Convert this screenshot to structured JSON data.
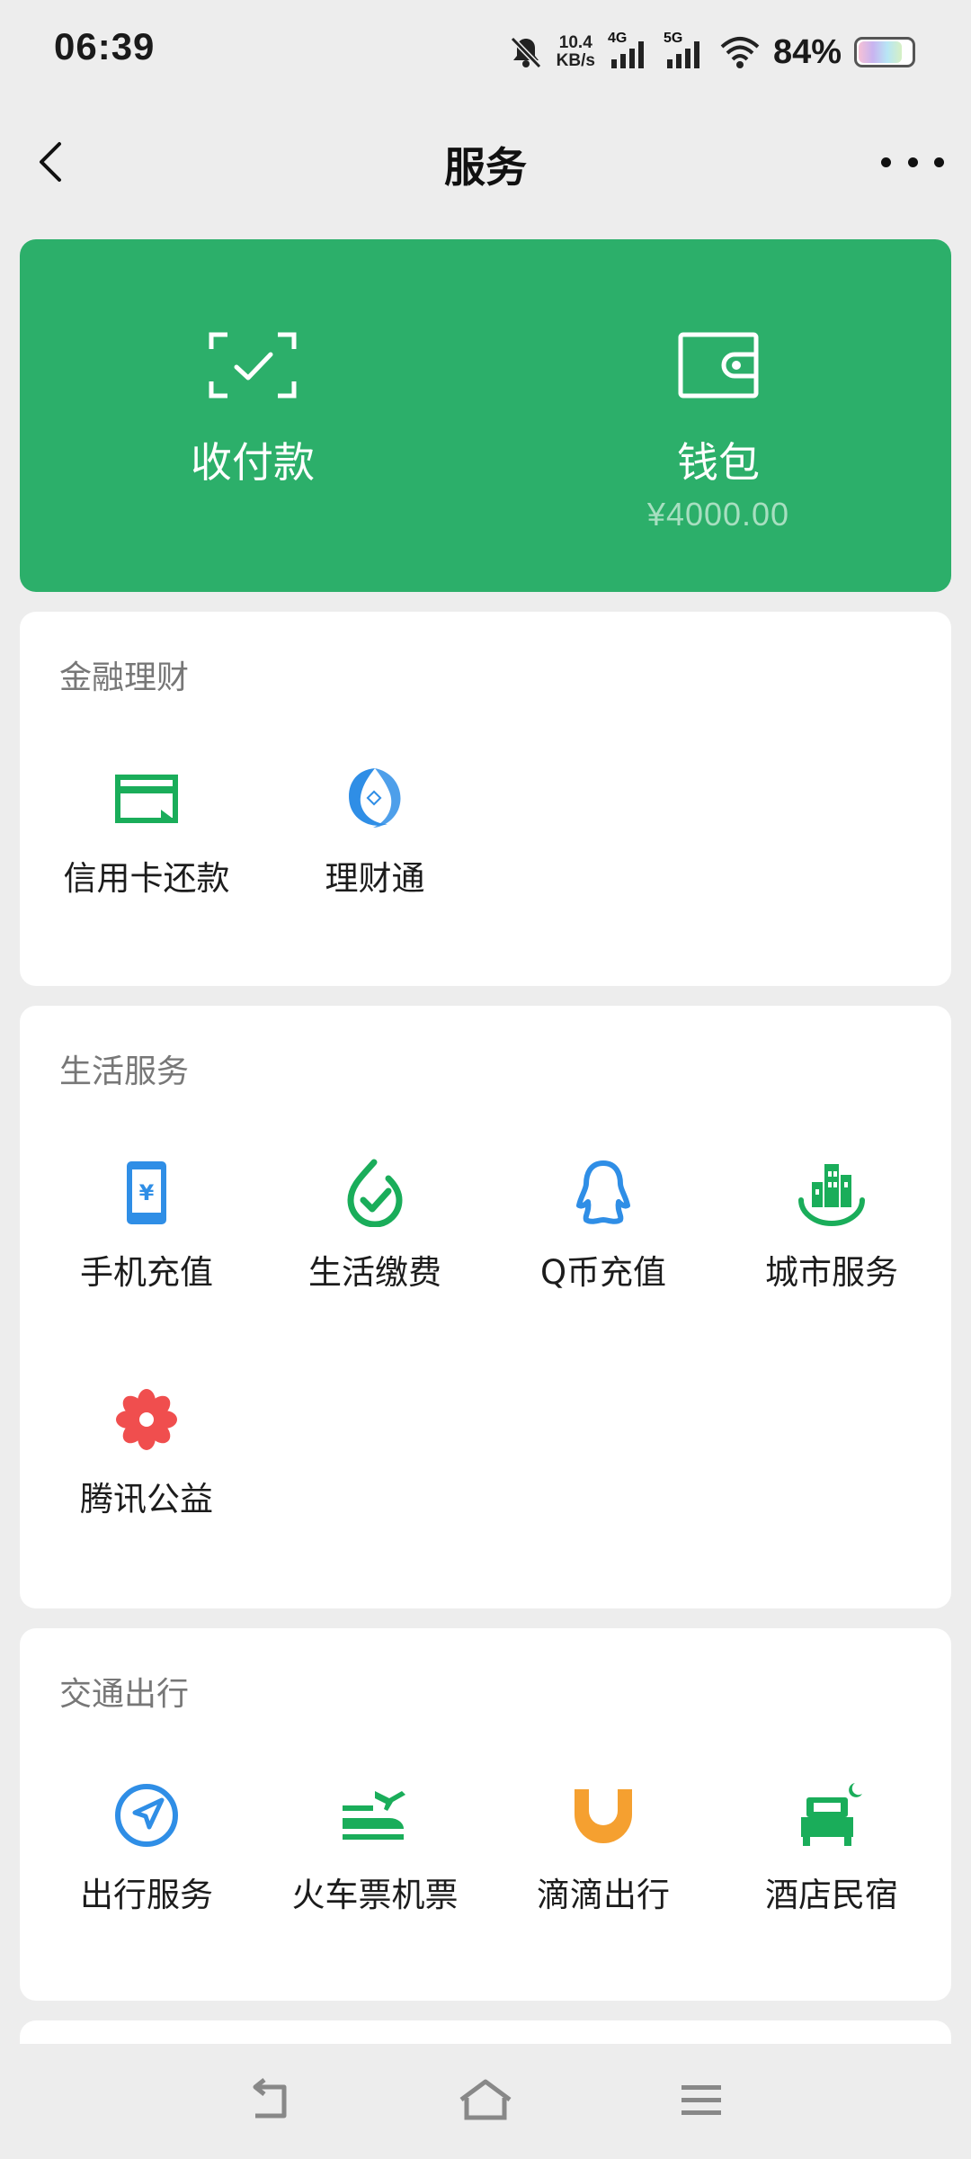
{
  "status": {
    "time": "06:39",
    "speed_top": "10.4",
    "speed_bottom": "KB/s",
    "net1": "4G",
    "net2": "5G",
    "battery": "84%",
    "battery_level": 0.84
  },
  "header": {
    "title": "服务"
  },
  "hero": {
    "pay": {
      "label": "收付款"
    },
    "wallet": {
      "label": "钱包",
      "amount": "¥4000.00"
    }
  },
  "finance": {
    "title": "金融理财",
    "items": [
      {
        "label": "信用卡还款",
        "icon": "credit-card-icon"
      },
      {
        "label": "理财通",
        "icon": "wealth-icon"
      }
    ]
  },
  "life": {
    "title": "生活服务",
    "items": [
      {
        "label": "手机充值",
        "icon": "phone-topup-icon"
      },
      {
        "label": "生活缴费",
        "icon": "utility-payment-icon"
      },
      {
        "label": "Q币充值",
        "icon": "qq-penguin-icon"
      },
      {
        "label": "城市服务",
        "icon": "city-buildings-icon"
      },
      {
        "label": "腾讯公益",
        "icon": "flower-icon"
      }
    ]
  },
  "transport": {
    "title": "交通出行",
    "items": [
      {
        "label": "出行服务",
        "icon": "navigation-icon"
      },
      {
        "label": "火车票机票",
        "icon": "train-plane-icon"
      },
      {
        "label": "滴滴出行",
        "icon": "didi-icon"
      },
      {
        "label": "酒店民宿",
        "icon": "hotel-bed-icon"
      }
    ]
  },
  "colors": {
    "brand_green": "#2caf6a",
    "icon_green": "#1aad5a",
    "icon_blue": "#2f8ee6",
    "icon_orange": "#f5a030",
    "icon_red": "#f04e4e"
  }
}
